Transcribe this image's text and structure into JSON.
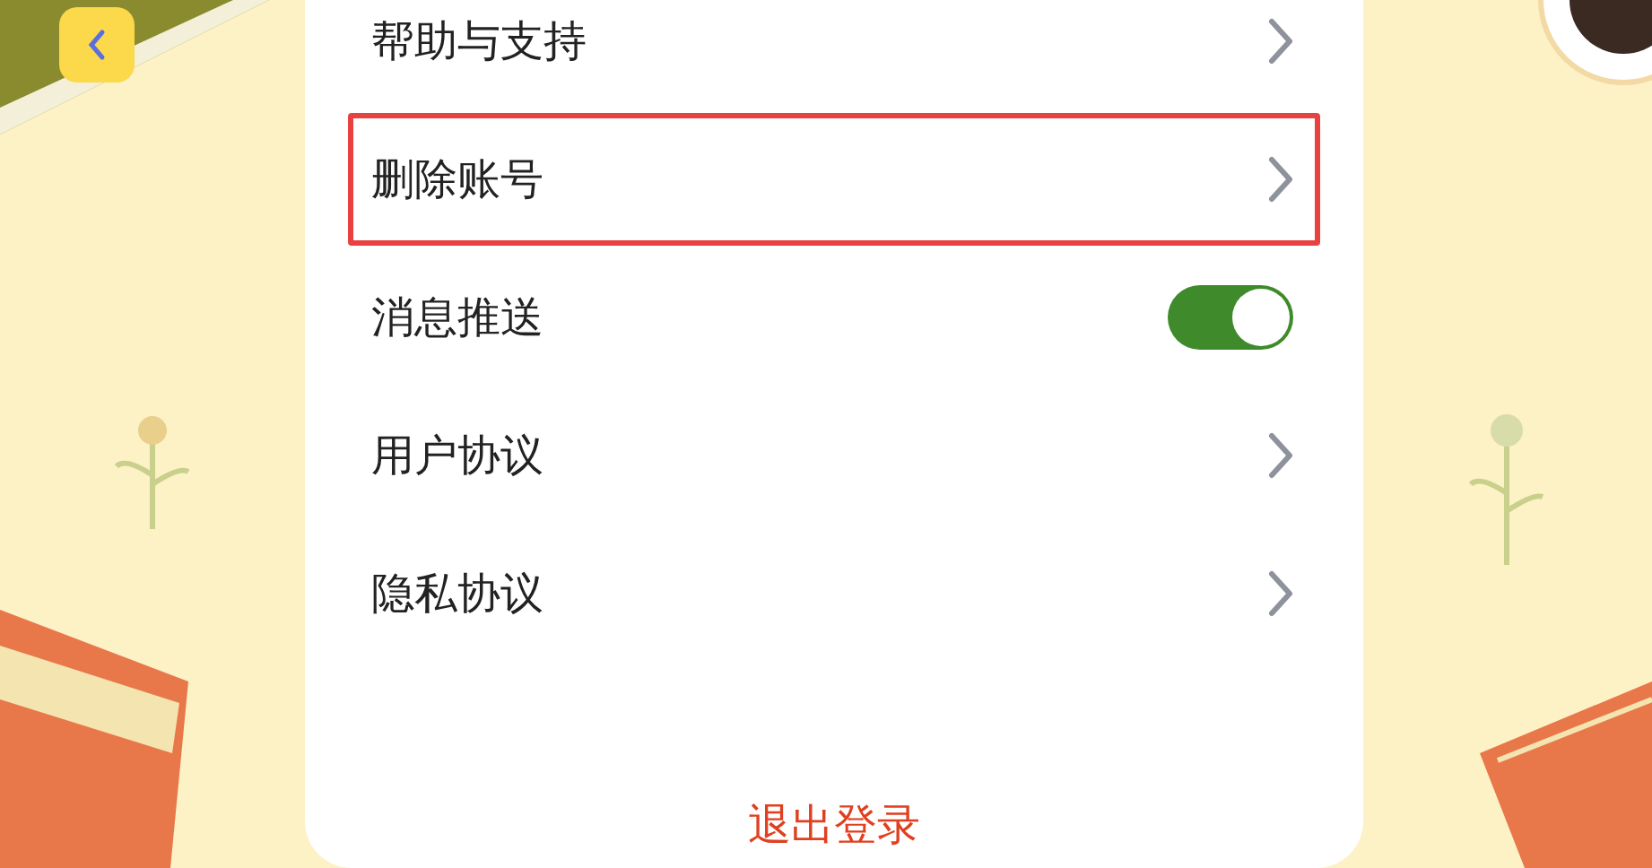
{
  "settings": [
    {
      "kind": "link",
      "label": "帮助与支持",
      "highlighted": false
    },
    {
      "kind": "link",
      "label": "删除账号",
      "highlighted": true
    },
    {
      "kind": "toggle",
      "label": "消息推送",
      "highlighted": false,
      "on": true
    },
    {
      "kind": "link",
      "label": "用户协议",
      "highlighted": false
    },
    {
      "kind": "link",
      "label": "隐私协议",
      "highlighted": false
    }
  ],
  "logout": "退出登录"
}
